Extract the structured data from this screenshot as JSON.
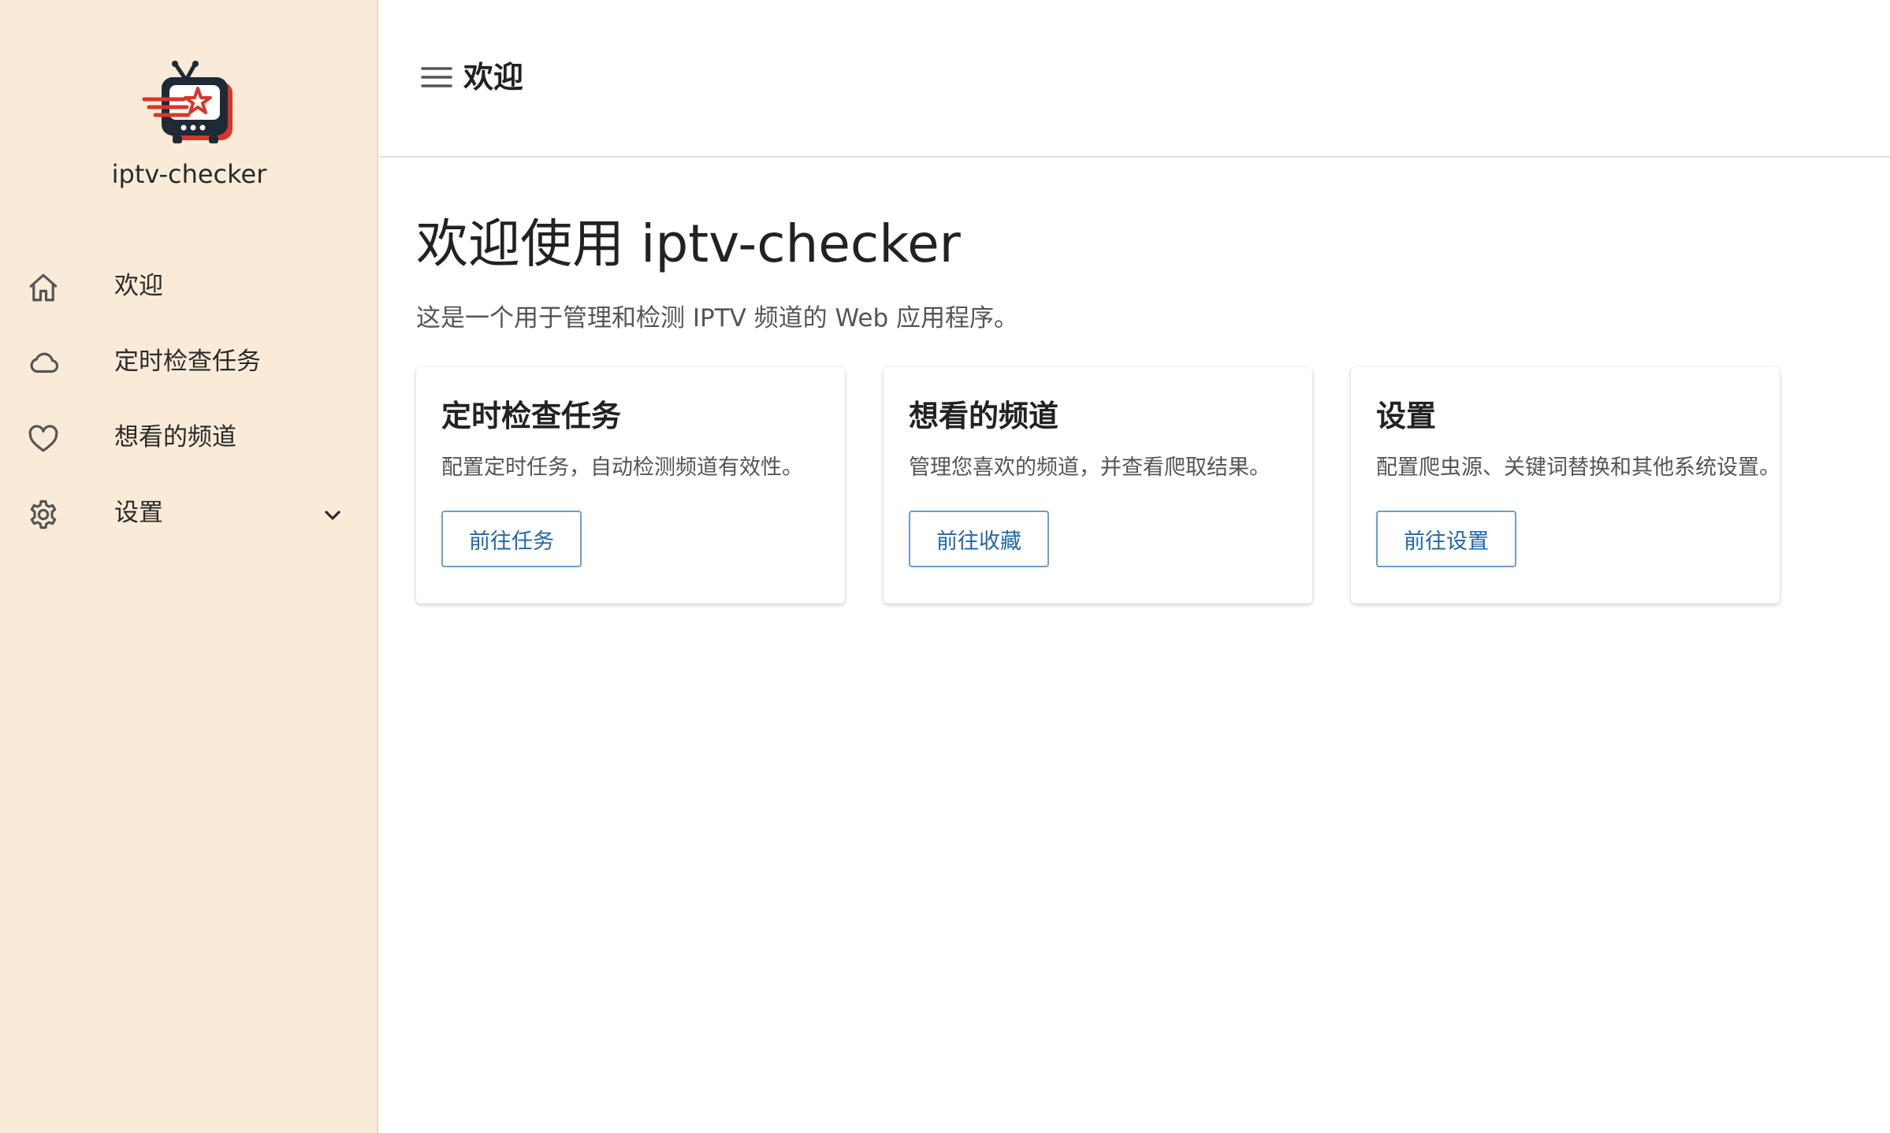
{
  "sidebar": {
    "app_name": "iptv-checker",
    "items": [
      {
        "label": "欢迎",
        "icon": "home-icon"
      },
      {
        "label": "定时检查任务",
        "icon": "cloud-icon"
      },
      {
        "label": "想看的频道",
        "icon": "heart-icon"
      },
      {
        "label": "设置",
        "icon": "gear-icon"
      }
    ]
  },
  "header": {
    "title": "欢迎"
  },
  "main": {
    "title": "欢迎使用 iptv-checker",
    "subtitle": "这是一个用于管理和检测 IPTV 频道的 Web 应用程序。",
    "cards": [
      {
        "title": "定时检查任务",
        "description": "配置定时任务，自动检测频道有效性。",
        "button": "前往任务"
      },
      {
        "title": "想看的频道",
        "description": "管理您喜欢的频道，并查看爬取结果。",
        "button": "前往收藏"
      },
      {
        "title": "设置",
        "description": "配置爬虫源、关键词替换和其他系统设置。",
        "button": "前往设置"
      }
    ]
  },
  "colors": {
    "sidebar_bg": "#faebd8",
    "accent": "#2167ad",
    "logo_red": "#d9362b",
    "logo_dark": "#1e2a36"
  }
}
